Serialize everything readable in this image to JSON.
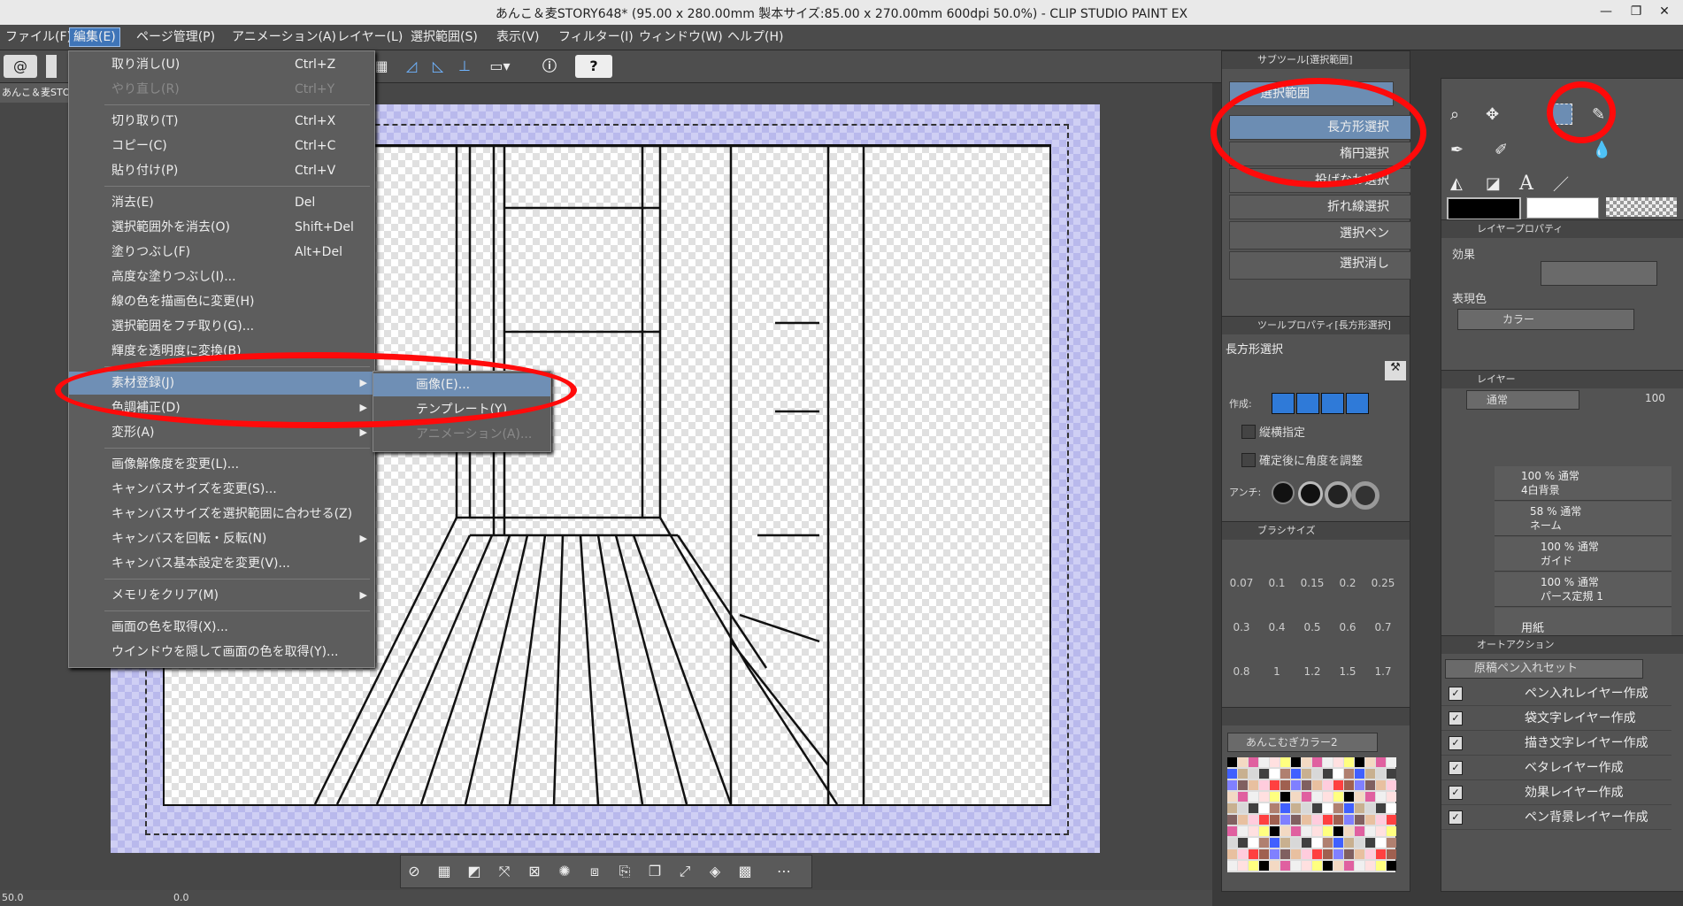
{
  "window": {
    "title": "あんこ＆麦STORY648* (95.00 x 280.00mm 製本サイズ:85.00 x 270.00mm 600dpi 50.0%) - CLIP STUDIO PAINT EX",
    "min_glyph": "—",
    "max_glyph": "❐",
    "close_glyph": "✕"
  },
  "menubar": {
    "items": [
      "ファイル(F)",
      "編集(E)",
      "ページ管理(P)",
      "アニメーション(A)",
      "レイヤー(L)",
      "選択範囲(S)",
      "表示(V)",
      "フィルター(I)",
      "ウィンドウ(W)",
      "ヘルプ(H)"
    ]
  },
  "document_tab": "あんこ＆麦STO",
  "edit_menu": [
    {
      "label": "取り消し(U)",
      "shortcut": "Ctrl+Z"
    },
    {
      "label": "やり直し(R)",
      "shortcut": "Ctrl+Y",
      "disabled": true
    },
    {
      "label": "切り取り(T)",
      "shortcut": "Ctrl+X"
    },
    {
      "label": "コピー(C)",
      "shortcut": "Ctrl+C"
    },
    {
      "label": "貼り付け(P)",
      "shortcut": "Ctrl+V"
    },
    {
      "label": "消去(E)",
      "shortcut": "Del"
    },
    {
      "label": "選択範囲外を消去(O)",
      "shortcut": "Shift+Del"
    },
    {
      "label": "塗りつぶし(F)",
      "shortcut": "Alt+Del"
    },
    {
      "label": "高度な塗りつぶし(I)...",
      "shortcut": ""
    },
    {
      "label": "線の色を描画色に変更(H)",
      "shortcut": ""
    },
    {
      "label": "選択範囲をフチ取り(G)...",
      "shortcut": ""
    },
    {
      "label": "輝度を透明度に変換(B)",
      "shortcut": ""
    },
    {
      "label": "素材登録(J)",
      "shortcut": "",
      "submenu": true
    },
    {
      "label": "色調補正(D)",
      "shortcut": "",
      "submenu": true
    },
    {
      "label": "変形(A)",
      "shortcut": "",
      "submenu": true
    },
    {
      "label": "画像解像度を変更(L)...",
      "shortcut": ""
    },
    {
      "label": "キャンバスサイズを変更(S)...",
      "shortcut": ""
    },
    {
      "label": "キャンバスサイズを選択範囲に合わせる(Z)",
      "shortcut": ""
    },
    {
      "label": "キャンバスを回転・反転(N)",
      "shortcut": "",
      "submenu": true
    },
    {
      "label": "キャンバス基本設定を変更(V)...",
      "shortcut": ""
    },
    {
      "label": "メモリをクリア(M)",
      "shortcut": "",
      "submenu": true
    },
    {
      "label": "画面の色を取得(X)...",
      "shortcut": ""
    },
    {
      "label": "ウインドウを隠して画面の色を取得(Y)...",
      "shortcut": ""
    }
  ],
  "submenu": [
    {
      "label": "画像(E)..."
    },
    {
      "label": "テンプレート(Y)..."
    },
    {
      "label": "アニメーション(A)...",
      "disabled": true
    }
  ],
  "subtool_panel": {
    "header": "サブツール[選択範囲]",
    "group": "選択範囲",
    "tools": [
      "長方形選択",
      "楕円選択",
      "投げなわ選択",
      "折れ線選択",
      "選択ペン",
      "選択消し"
    ]
  },
  "tool_property": {
    "header": "ツールプロパティ[長方形選択]",
    "name": "長方形選択",
    "mode_label": "作成:",
    "aspect_label": "縦横指定",
    "angle_label": "確定後に角度を調整",
    "antialias_label": "アンチ:"
  },
  "brush_size": {
    "header": "ブラシサイズ",
    "sizes": [
      "0.07",
      "0.1",
      "0.15",
      "0.2",
      "0.25",
      "0.3",
      "0.4",
      "0.5",
      "0.6",
      "0.7",
      "0.8",
      "1",
      "1.2",
      "1.5",
      "1.7"
    ]
  },
  "color_set": {
    "name": "あんこむぎカラー2"
  },
  "layer_property": {
    "header": "レイヤープロパティ",
    "effect_label": "効果",
    "expression_label": "表現色",
    "expression_value": "カラー"
  },
  "layer_panel": {
    "header": "レイヤー",
    "blend_mode": "通常",
    "opacity": "100",
    "layers": [
      {
        "line1": "100 % 通常",
        "line2": "4白背景"
      },
      {
        "line1": "58 % 通常",
        "line2": "ネーム"
      },
      {
        "line1": "100 % 通常",
        "line2": "ガイド"
      },
      {
        "line1": "100 % 通常",
        "line2": "パース定規 1"
      },
      {
        "line1": "",
        "line2": "用紙"
      }
    ]
  },
  "auto_action": {
    "header": "オートアクション",
    "set_name": "原稿ペン入れセット",
    "actions": [
      "ペン入れレイヤー作成",
      "袋文字レイヤー作成",
      "描き文字レイヤー作成",
      "ベタレイヤー作成",
      "効果レイヤー作成",
      "ペン背景レイヤー作成"
    ]
  },
  "status": {
    "zoom": "50.0",
    "angle": "0.0"
  },
  "colors": {
    "accent": "#3f75b8",
    "annotation": "#ff0a0a"
  }
}
